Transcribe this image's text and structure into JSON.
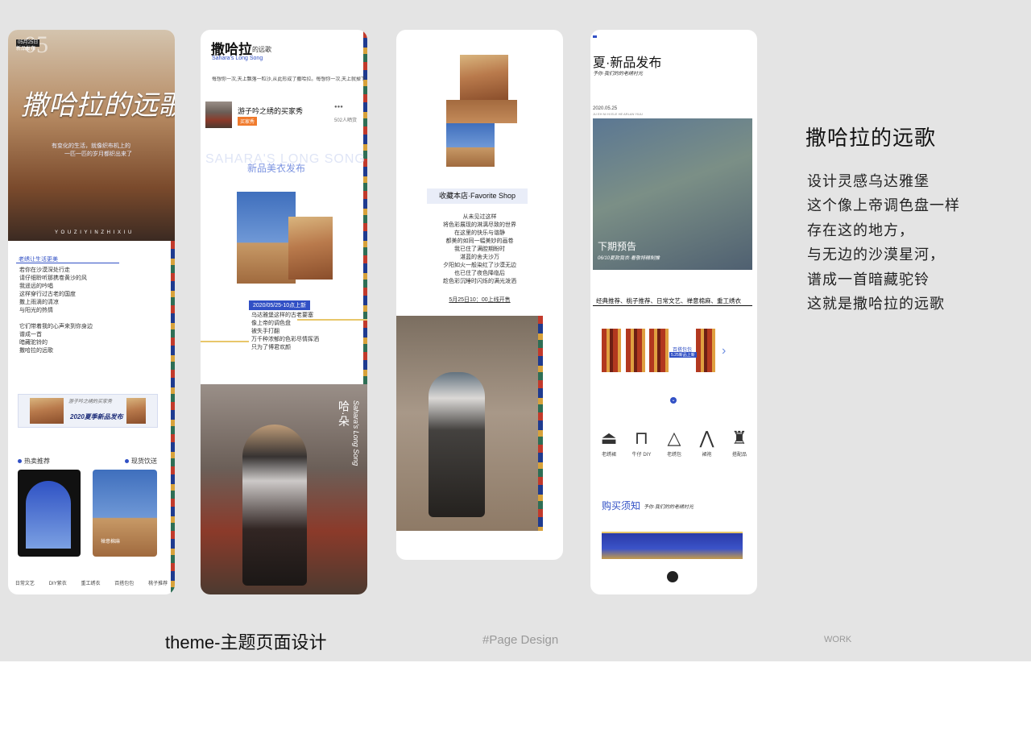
{
  "sidebar": {
    "title": "撒哈拉的远歌",
    "lines": [
      "设计灵感乌达雅堡",
      "这个像上帝调色盘一样",
      "存在这的地方，",
      "与无边的沙漠星河，",
      "谱成一首暗藏驼铃",
      "这就是撒哈拉的远歌"
    ]
  },
  "captions": {
    "theme": "theme-主题页面设计",
    "page_design": "#Page Design",
    "work": "WORK"
  },
  "card1": {
    "date_badge": "05月25日",
    "date_sub": "新品发布",
    "big_num": "05",
    "calligraphy": "撒哈拉的远歌",
    "intro_line1": "有变化的生活，就像织布机上的",
    "intro_line2": "一匹一匹的岁月都织出来了",
    "pinyin": "Y O U Z I Y I N Z H I X I U",
    "section_title": "老绣让生活更美",
    "poem": [
      "若你在沙漠深处行走",
      "请仔细聆听那携卷黄沙的风",
      "我遥远的吟唱",
      "这样穿行过古老的国度",
      "撒上雨滴的清凉",
      "与阳光的热情",
      "",
      "它们带着我的心声来到你身边",
      "谱成一首",
      "暗藏驼铃的",
      "撒哈拉的远歌"
    ],
    "banner_small": "游子吟之绣的买家秀",
    "banner_title": "2020夏季新品发布",
    "hot": "热卖推荐",
    "stock": "现货饮送",
    "photo_label": "禅意棉麻",
    "nav": [
      "日常文艺",
      "DIY紫衣",
      "重工绣衣",
      "百搭包包",
      "桃子推荐"
    ]
  },
  "card2": {
    "title": "撒哈拉",
    "title_suffix": "的远歌",
    "subtitle": "Sahara's Long Song",
    "desc": "每想你一次,天上飘落一粒沙,从此形成了撒哈拉。每想你一次,天上就掉下一滴水,",
    "shop_name": "游子吟之绣的买家秀",
    "shop_tag": "买家秀",
    "followers": "502人晒货",
    "watermark": "SAHARA'S LONG SONG",
    "section": "新品美衣发布",
    "date_bar": "2020/05/25-10点上新",
    "poem": [
      "乌达雅堡这样的古老要塞",
      "像上帝的调色盘",
      "被失手打翻",
      "万千种浓郁的色彩尽情挥洒",
      "只为了博君欢颜"
    ],
    "vertical": "哈·朵",
    "vertical_en": "Sahara's Long Song"
  },
  "card3": {
    "fav": "收藏本店·Favorite Shop",
    "poem": [
      "从未见过这样",
      "将色彩展现的淋漓尽致的世界",
      "在这里的快乐与谐静",
      "都美的如同一幅美妙的画卷",
      "我已住了满腔期盼时",
      "湛蓝的舍夫沙万",
      "夕阳如火一般染红了沙漠无边",
      "也已住了夜色降临后",
      "趁色彩沉睡时闪烁的满光泼洒"
    ],
    "launch": "5月25日10：00上线开售"
  },
  "card4": {
    "title": "夏·新品发布",
    "subtitle": "予你·我们的的老绣衬光",
    "date": "2020.05.25",
    "date_sub": "JU EH NI HI ELE HE ARLAN YIUU",
    "next": "下期预告",
    "next_sub": "06/10夏款我衣·看敬特精制推",
    "categories": "经典推荐、桃子推荐、日常文艺、禅意棉麻、重工绣衣",
    "promo": "百搭包包",
    "promo_sub": "5.25新品上新",
    "icons": [
      "老绣裙",
      "牛仔 DIY",
      "老绣包",
      "裙袍",
      "搭配品"
    ],
    "buy": "购买须知",
    "buy_sub": "予你·我们的的老绣衬光"
  },
  "colors": {
    "accent": "#3150c5",
    "stage": "#e4e4e4",
    "tag_orange": "#f07a2c"
  }
}
